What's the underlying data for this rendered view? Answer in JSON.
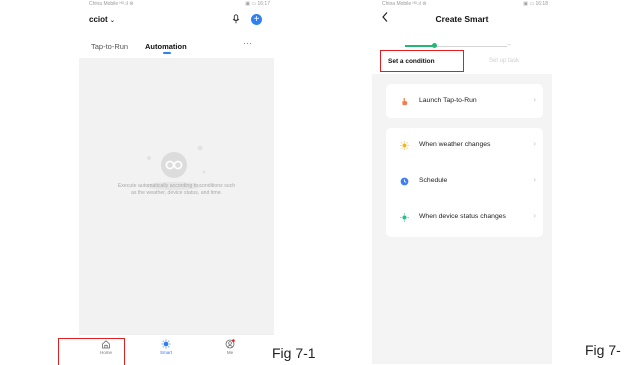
{
  "phone1": {
    "status": {
      "carrier": "China Mobile ᴴᴰ.ıl ⊜",
      "right": "▣ ▭ 16:17"
    },
    "home_name": "cciot",
    "tabs": {
      "tap_to_run": "Tap-to-Run",
      "automation": "Automation"
    },
    "more": "···",
    "empty_text": [
      "Execute automatically according to conditions such",
      "as the weather, device status, and time."
    ],
    "bottom_nav": {
      "home": "Home",
      "smart": "Smart",
      "me": "Me"
    }
  },
  "phone2": {
    "status": {
      "carrier": "China Mobile ᴴᴰ.ıl ⊜",
      "right": "▣ ▭ 16:18"
    },
    "title": "Create Smart",
    "steps": {
      "step1": "Set a condition",
      "step2": "Set up task"
    },
    "options": [
      {
        "label": "Launch Tap-to-Run",
        "icon": "hand-tap-icon"
      },
      {
        "label": "When weather changes",
        "icon": "sun-icon"
      },
      {
        "label": "Schedule",
        "icon": "clock-icon"
      },
      {
        "label": "When device status changes",
        "icon": "device-status-icon"
      }
    ]
  },
  "captions": {
    "fig1": "Fig 7-1",
    "fig2": "Fig 7-"
  },
  "colors": {
    "accent": "#2f80f3",
    "progress": "#22b873",
    "highlight": "#e02020"
  }
}
